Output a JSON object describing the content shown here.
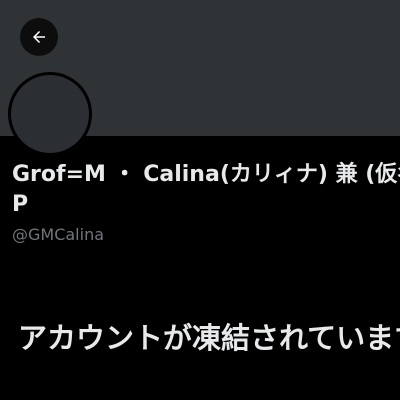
{
  "header": {
    "back_icon": "arrow-left-icon"
  },
  "profile": {
    "display_name": "Grof=M ・ Calina(カリィナ) 兼 (仮名P",
    "handle": "@GMCalina"
  },
  "notice": {
    "title": "アカウントが凍結されています"
  },
  "colors": {
    "background": "#000000",
    "banner": "#2f3336",
    "text_primary": "#e7e9ea",
    "text_secondary": "#71767b"
  }
}
